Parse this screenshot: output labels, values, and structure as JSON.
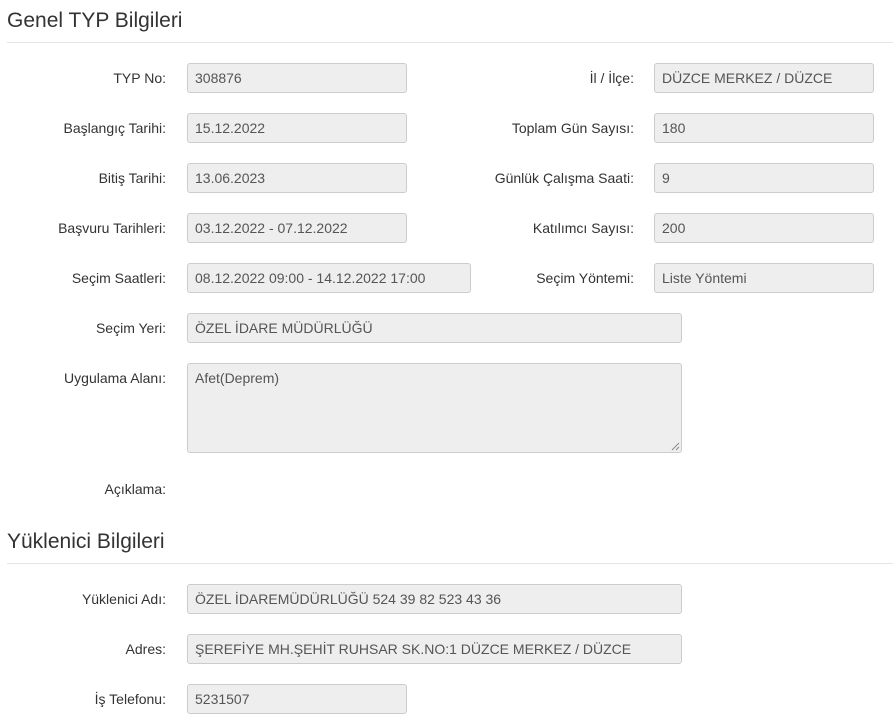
{
  "section_general": {
    "title": "Genel TYP Bilgileri",
    "typ_no": {
      "label": "TYP No:",
      "value": "308876"
    },
    "il_ilce": {
      "label": "İl / İlçe:",
      "value": "DÜZCE MERKEZ / DÜZCE"
    },
    "baslangic": {
      "label": "Başlangıç Tarihi:",
      "value": "15.12.2022"
    },
    "toplam_gun": {
      "label": "Toplam Gün Sayısı:",
      "value": "180"
    },
    "bitis": {
      "label": "Bitiş Tarihi:",
      "value": "13.06.2023"
    },
    "gunluk_saat": {
      "label": "Günlük Çalışma Saati:",
      "value": "9"
    },
    "basvuru": {
      "label": "Başvuru Tarihleri:",
      "value": "03.12.2022 - 07.12.2022"
    },
    "katilimci": {
      "label": "Katılımcı Sayısı:",
      "value": "200"
    },
    "secim_saatleri": {
      "label": "Seçim Saatleri:",
      "value": "08.12.2022 09:00 - 14.12.2022 17:00"
    },
    "secim_yontemi": {
      "label": "Seçim Yöntemi:",
      "value": "Liste Yöntemi"
    },
    "secim_yeri": {
      "label": "Seçim Yeri:",
      "value": "ÖZEL İDARE MÜDÜRLÜĞÜ"
    },
    "uygulama_alani": {
      "label": "Uygulama Alanı:",
      "value": "Afet(Deprem)"
    },
    "aciklama": {
      "label": "Açıklama:"
    }
  },
  "section_contractor": {
    "title": "Yüklenici Bilgileri",
    "adi": {
      "label": "Yüklenici Adı:",
      "value": "ÖZEL İDAREMÜDÜRLÜĞÜ 524 39 82 523 43 36"
    },
    "adres": {
      "label": "Adres:",
      "value": "ŞEREFİYE MH.ŞEHİT RUHSAR SK.NO:1 DÜZCE MERKEZ / DÜZCE"
    },
    "telefon": {
      "label": "İş Telefonu:",
      "value": "5231507"
    }
  }
}
